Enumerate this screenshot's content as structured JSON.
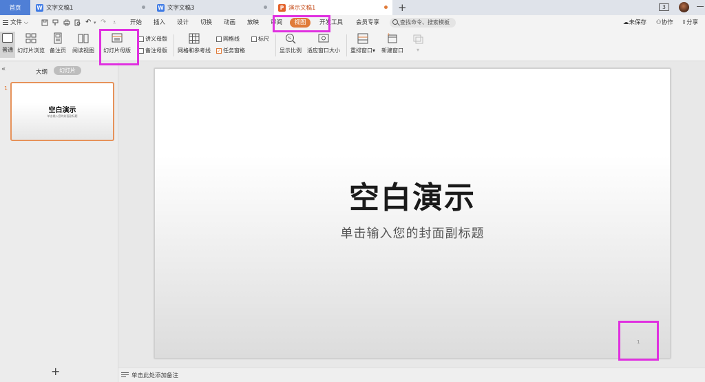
{
  "tabs": {
    "home": "首页",
    "doc1": "文字文稿1",
    "doc3": "文字文稿3",
    "ppt": "演示文稿1",
    "new_tab": "+",
    "window_count": "3"
  },
  "menu": {
    "file": "文件",
    "items": [
      "开始",
      "插入",
      "设计",
      "切换",
      "动画",
      "放映",
      "审阅",
      "视图",
      "开发工具",
      "会员专享"
    ],
    "active": "视图",
    "search_placeholder": "查找命令、搜索模板",
    "right": {
      "unsaved": "未保存",
      "collab": "协作",
      "share": "分享"
    }
  },
  "ribbon": {
    "normal": "普通",
    "slide_browse": "幻灯片浏览",
    "notes_page": "备注页",
    "reading_view": "阅读视图",
    "slide_master": "幻灯片母版",
    "handout_master": "讲义母版",
    "notes_master": "备注母版",
    "grid_guides": "网格和参考线",
    "gridlines": "网格线",
    "ruler": "标尺",
    "task_pane": "任务窗格",
    "zoom": "显示比例",
    "fit_window": "适应窗口大小",
    "rearrange": "重排窗口",
    "new_window": "新建窗口"
  },
  "left_panel": {
    "outline": "大纲",
    "slides": "幻灯片",
    "slide_number": "1",
    "add": "+"
  },
  "slide": {
    "title": "空白演示",
    "subtitle": "单击输入您的封面副标题",
    "page_number": "1"
  },
  "notes": {
    "placeholder": "单击此处添加备注"
  },
  "colors": {
    "accent": "#e07b39",
    "highlight": "#e030e0",
    "home_tab": "#4f7fd6"
  }
}
